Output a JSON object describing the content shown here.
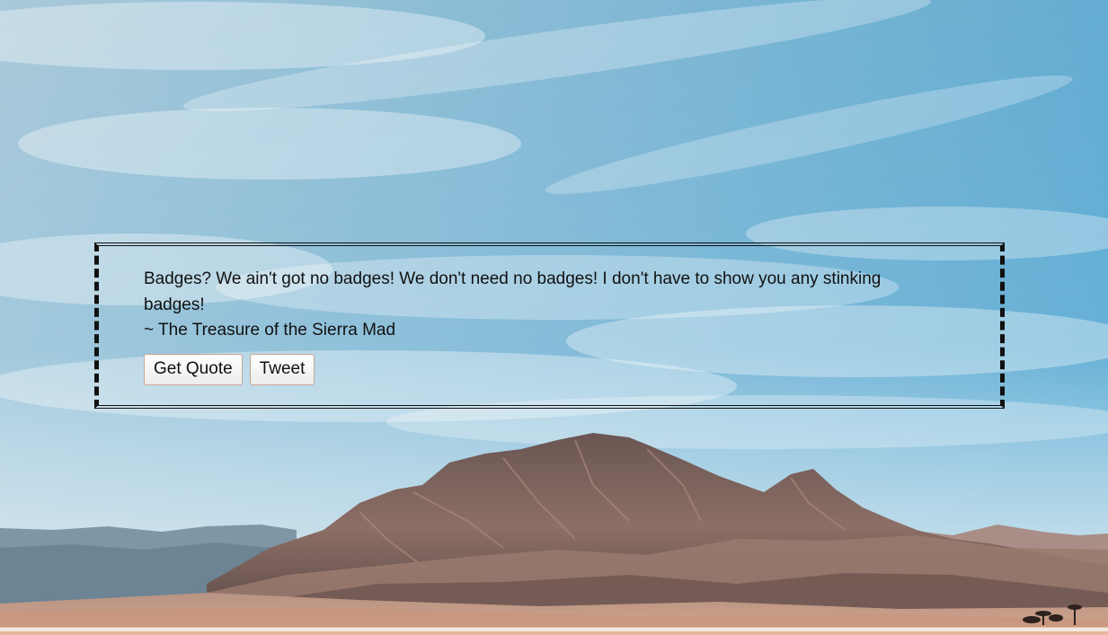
{
  "quote": {
    "text": "Badges? We ain't got no badges! We don't need no badges! I don't have to show you any stinking badges!",
    "author": "~ The Treasure of the Sierra Mad"
  },
  "buttons": {
    "get_quote_label": "Get Quote",
    "tweet_label": "Tweet"
  },
  "colors": {
    "sky_top": "#4ea4cf",
    "sky_bottom": "#cfe3ec",
    "mountain": "#7a6058",
    "desert": "#c9a08a",
    "box_border": "#111111"
  }
}
